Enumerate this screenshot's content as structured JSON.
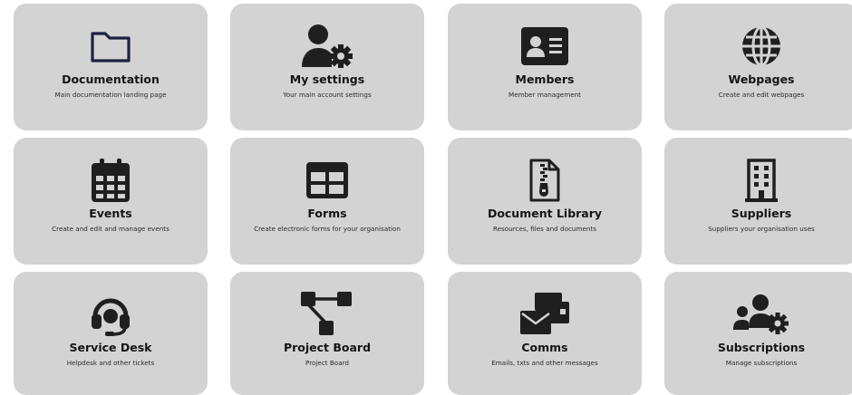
{
  "tiles": [
    {
      "title": "Documentation",
      "description": "Main documentation landing page",
      "icon": "folder-icon"
    },
    {
      "title": "My settings",
      "description": "Your main account settings",
      "icon": "user-gear-icon"
    },
    {
      "title": "Members",
      "description": "Member management",
      "icon": "id-card-icon"
    },
    {
      "title": "Webpages",
      "description": "Create and edit webpages",
      "icon": "globe-icon"
    },
    {
      "title": "Events",
      "description": "Create and edit and manage events",
      "icon": "calendar-icon"
    },
    {
      "title": "Forms",
      "description": "Create electronic forms for your organisation",
      "icon": "table-icon"
    },
    {
      "title": "Document Library",
      "description": "Resources, files and documents",
      "icon": "file-zipper-icon"
    },
    {
      "title": "Suppliers",
      "description": "Suppliers your organisation uses",
      "icon": "building-icon"
    },
    {
      "title": "Service Desk",
      "description": "Helpdesk and other tickets",
      "icon": "headset-icon"
    },
    {
      "title": "Project Board",
      "description": "Project Board",
      "icon": "sitemap-icon"
    },
    {
      "title": "Comms",
      "description": "Emails, txts and other messages",
      "icon": "mail-bulk-icon"
    },
    {
      "title": "Subscriptions",
      "description": "Manage subscriptions",
      "icon": "users-cog-icon"
    }
  ],
  "colors": {
    "tile_background": "#d3d3d3",
    "icon": "#1f1f1f",
    "folder_outline": "#1b2340"
  }
}
